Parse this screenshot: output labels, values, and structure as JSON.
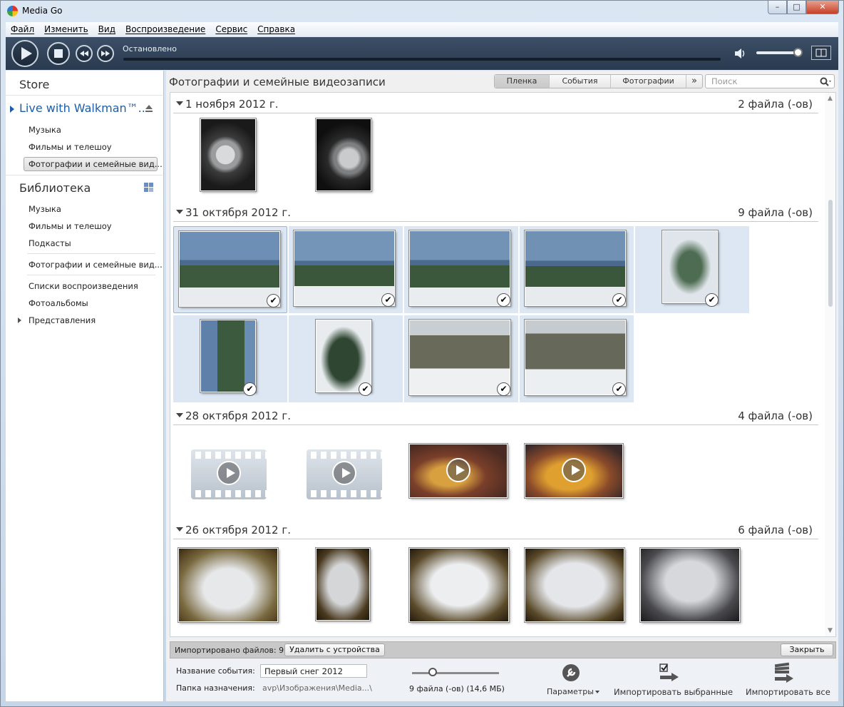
{
  "window": {
    "title": "Media Go"
  },
  "menu": [
    "Файл",
    "Изменить",
    "Вид",
    "Воспроизведение",
    "Сервис",
    "Справка"
  ],
  "player": {
    "status": "Остановлено",
    "volume_fraction": 0.85
  },
  "sidebar": {
    "store": "Store",
    "device": "Live with Walkman™...",
    "device_items": [
      "Музыка",
      "Фильмы и телешоу",
      "Фотографии и семейные вид..."
    ],
    "library": "Библиотека",
    "library_items": [
      "Музыка",
      "Фильмы и телешоу",
      "Подкасты",
      "Фотографии и семейные вид...",
      "Списки воспроизведения",
      "Фотоальбомы",
      "Представления"
    ]
  },
  "main": {
    "title": "Фотографии и семейные видеозаписи",
    "tabs": [
      "Пленка",
      "События",
      "Фотографии",
      "»"
    ],
    "search_placeholder": "Поиск"
  },
  "groups": [
    {
      "date": "1 ноября 2012 г.",
      "count": "2 файла (-ов)"
    },
    {
      "date": "31 октября 2012 г.",
      "count": "9 файла (-ов)"
    },
    {
      "date": "28 октября 2012 г.",
      "count": "4 файла (-ов)"
    },
    {
      "date": "26 октября 2012 г.",
      "count": "6 файла (-ов)"
    }
  ],
  "infobar": {
    "text": "Импортировано файлов: 9.",
    "delete_btn": "Удалить с устройства",
    "close_btn": "Закрыть"
  },
  "footer": {
    "event_label": "Название события:",
    "event_value": "Первый снег 2012",
    "folder_label": "Папка назначения:",
    "folder_value": "avp\\Изображения\\Media...\\",
    "size_text": "9 файла (-ов) (14,6 МБ)",
    "params": "Параметры",
    "import_selected": "Импортировать выбранные",
    "import_all": "Импортировать все"
  },
  "check_glyph": "✔",
  "colors": {
    "accent": "#1d5ea8",
    "selection": "#dce7f3",
    "player": "#2a3a4f"
  }
}
